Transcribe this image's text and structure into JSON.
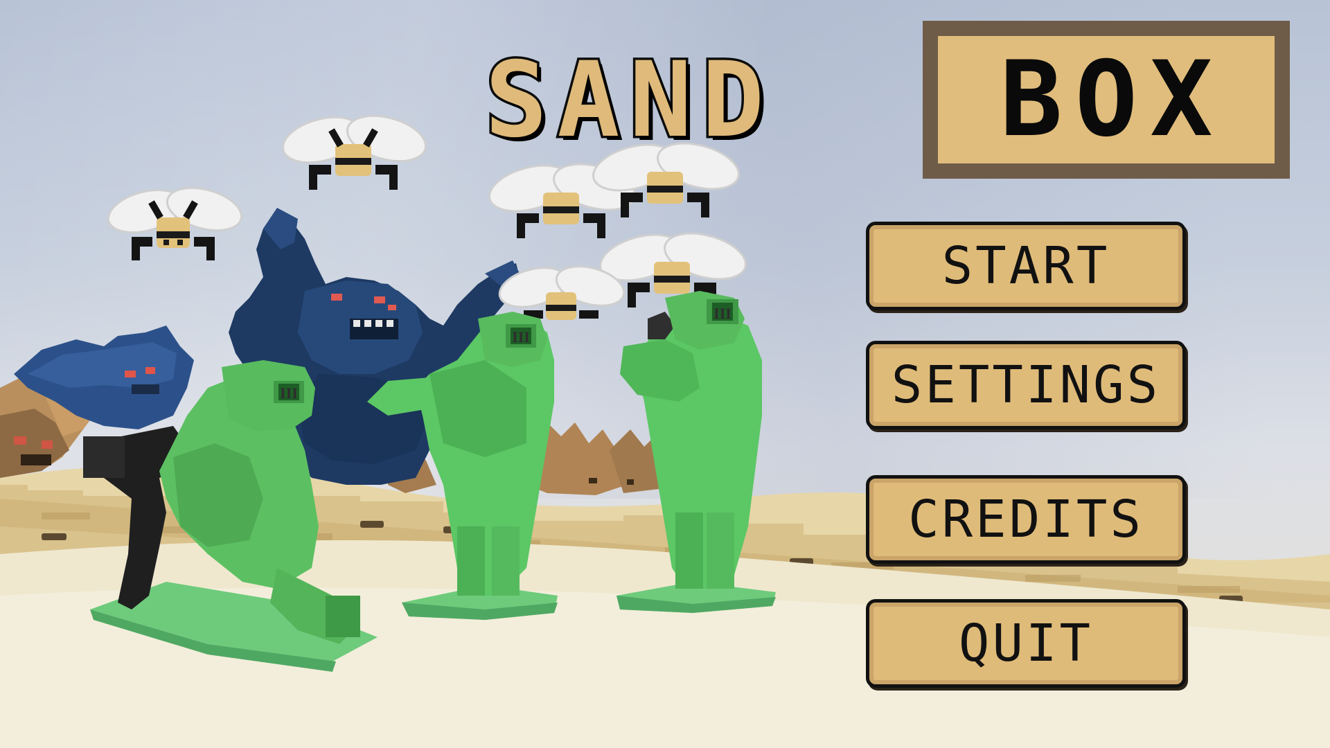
{
  "title": {
    "word1": "SAND",
    "word2": "BOX"
  },
  "menu": {
    "start": "START",
    "settings": "SETTINGS",
    "credits": "CREDITS",
    "quit": "QUIT"
  },
  "soldier_badge": "III",
  "colors": {
    "sky": "#c2ccdb",
    "sand": "#e9dcb2",
    "button_fill": "#dfbb79",
    "button_border": "#111111",
    "title_box_frame": "#6e5c48",
    "soldier_green": "#5fc25a",
    "monster_blue": "#1f3f6a",
    "bee_yellow": "#e2c27a"
  }
}
